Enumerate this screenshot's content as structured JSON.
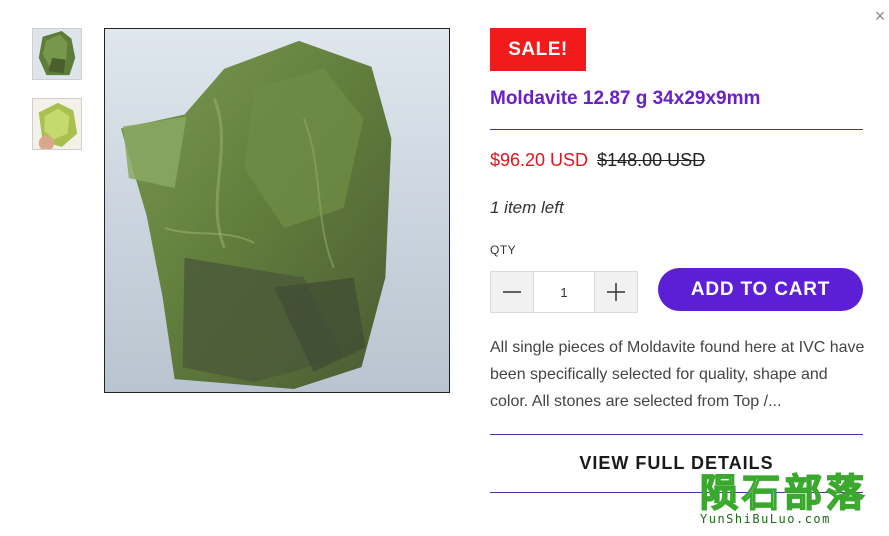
{
  "dialog": {
    "close_label": "×"
  },
  "gallery": {
    "thumbnails": [
      {
        "alt": "moldavite-thumbnail-1"
      },
      {
        "alt": "moldavite-thumbnail-2"
      }
    ]
  },
  "product": {
    "sale_badge": "SALE!",
    "title": "Moldavite 12.87 g 34x29x9mm",
    "price_current": "$96.20 USD",
    "price_original": "$148.00 USD",
    "stock_note": "1 item left",
    "qty_label": "QTY",
    "qty_value": "1",
    "add_to_cart_label": "ADD TO CART",
    "description": "All single pieces of Moldavite found here at IVC have been specifically selected for quality, shape and color. All stones are selected from Top /...",
    "view_details_label": "VIEW FULL DETAILS"
  },
  "watermark": {
    "text": "陨石部落",
    "url": "YunShiBuLuo.com"
  },
  "colors": {
    "accent": "#5d1fd6",
    "title": "#6a20c9",
    "sale": "#f21a1a",
    "price": "#e1151d"
  }
}
